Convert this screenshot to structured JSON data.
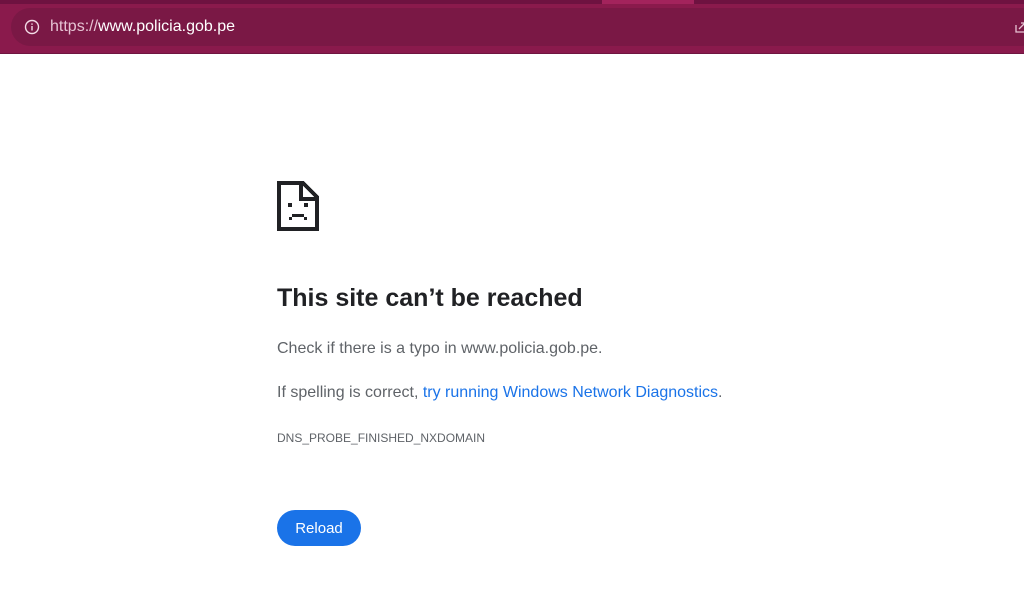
{
  "browser": {
    "url_scheme": "https://",
    "url_host": "www.policia.gob.pe",
    "toolbar_color": "#8a1a4c"
  },
  "icons": {
    "site_info": "info-icon",
    "error_page": "sad-page-icon",
    "share": "share-icon"
  },
  "error": {
    "title": "This site can’t be reached",
    "check_typo_text": "Check if there is a typo in www.policia.gob.pe.",
    "spelling_prefix": "If spelling is correct, ",
    "diagnostics_link": "try running Windows Network Diagnostics",
    "spelling_suffix": ".",
    "code": "DNS_PROBE_FINISHED_NXDOMAIN",
    "reload_label": "Reload"
  },
  "colors": {
    "link": "#1a73e8",
    "button": "#1a73e8",
    "heading": "#202124",
    "body_text": "#5f6368"
  }
}
